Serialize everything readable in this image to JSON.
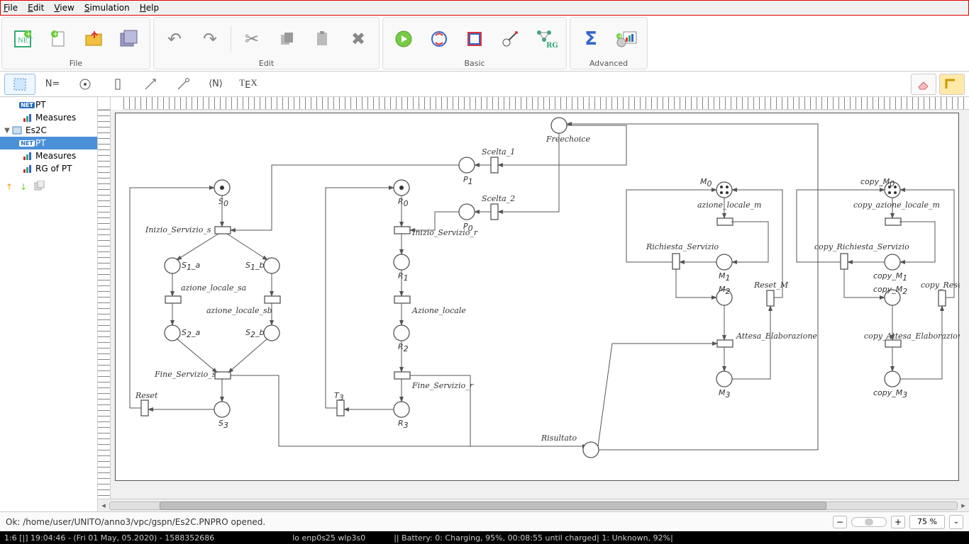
{
  "menu": {
    "file": "File",
    "edit": "Edit",
    "view": "View",
    "simulation": "Simulation",
    "help": "Help"
  },
  "toolgroups": {
    "file": "File",
    "edit": "Edit",
    "basic": "Basic",
    "advanced": "Advanced"
  },
  "secondbar": {
    "neq": "N=",
    "angleN": "⟨N⟩",
    "tex": "TEX"
  },
  "tree": {
    "pt1": "PT",
    "measures1": "Measures",
    "proj": "Es2C",
    "pt2": "PT",
    "measures2": "Measures",
    "rg": "RG of PT"
  },
  "canvas": {
    "freechoice": "Freechoice",
    "scelta1": "Scelta_1",
    "p1": "P",
    "p1sub": "1",
    "scelta2": "Scelta_2",
    "p0": "P",
    "p0sub": "0",
    "s0": "S",
    "s0sub": "0",
    "inizio_s": "Inizio_Servizio_s",
    "s1a": "S",
    "s1asub": "1",
    "s1a2": "_a",
    "s1b": "S",
    "s1bsub": "1",
    "s1b2": "_b",
    "azione_sa": "azione_locale_sa",
    "azione_sb": "azione_locale_sb",
    "s2a": "S",
    "s2asub": "2",
    "s2a2": "_a",
    "s2b": "S",
    "s2bsub": "2",
    "s2b2": "_b",
    "fine_s": "Fine_Servizio_s",
    "reset": "Reset",
    "s3": "S",
    "s3sub": "3",
    "r0": "R",
    "r0sub": "0",
    "inizio_r": "Inizio_Servizio_r",
    "r1": "R",
    "r1sub": "1",
    "azione_locale": "Azione_locale",
    "r2": "R",
    "r2sub": "2",
    "fine_r": "Fine_Servizio_r",
    "t3": "T",
    "t3sub": "3",
    "r3": "R",
    "r3sub": "3",
    "risultato": "Risultato",
    "m0": "M",
    "m0sub": "0",
    "azione_m": "azione_locale_m",
    "richiesta": "Richiesta_Servizio",
    "m1": "M",
    "m1sub": "1",
    "m2": "M",
    "m2sub": "2",
    "reset_m": "Reset_M",
    "attesa": "Attesa_Elaborazione",
    "m3": "M",
    "m3sub": "3",
    "copy_m0": "copy_M",
    "copy_m0sub": "0",
    "copy_azione_m": "copy_azione_locale_m",
    "copy_richiesta": "copy_Richiesta_Servizio",
    "copy_m1": "copy_M",
    "copy_m1sub": "1",
    "copy_m2": "copy_M",
    "copy_m2sub": "2",
    "copy_reset_m": "copy_Reset_M",
    "copy_attesa": "copy_Attesa_Elaborazione",
    "copy_m3": "copy_M",
    "copy_m3sub": "3"
  },
  "status": {
    "msg": "Ok: /home/user/UNITO/anno3/vpc/gspn/Es2C.PNPRO opened.",
    "zoom": "75 %"
  },
  "taskbar": {
    "left": "1:6 [|]    19:04:46 - (Fri 01 May, 05.2020) - 1588352686",
    "mid": "lo enp0s25 wlp3s0",
    "right": "||   Battery: 0: Charging, 95%, 00:08:55 until charged| 1: Unknown, 92%|"
  }
}
